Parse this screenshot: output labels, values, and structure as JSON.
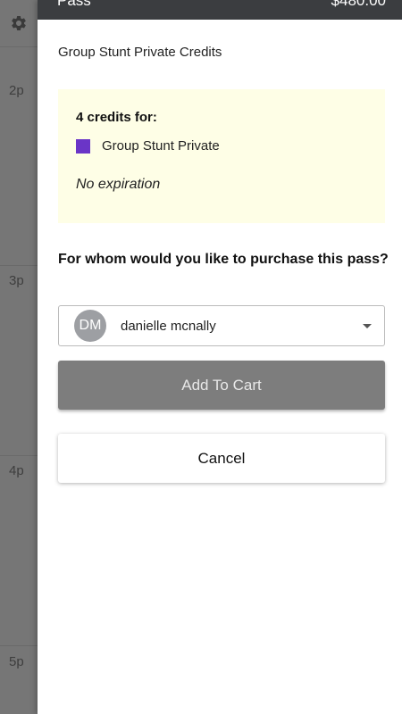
{
  "background": {
    "settings_icon": "gear-icon",
    "time_labels": [
      "2p",
      "3p",
      "4p",
      "5p"
    ]
  },
  "drawer": {
    "header": {
      "title": "Pass",
      "price": "$480.00"
    },
    "pass_name": "Group Stunt Private Credits",
    "credits": {
      "title": "4 credits for:",
      "item_label": "Group Stunt Private",
      "item_color": "#6a35c7",
      "expiration": "No expiration"
    },
    "question": "For whom would you like to purchase this pass?",
    "recipient": {
      "initials": "DM",
      "name": "danielle mcnally"
    },
    "add_to_cart_label": "Add To Cart",
    "cancel_label": "Cancel"
  }
}
